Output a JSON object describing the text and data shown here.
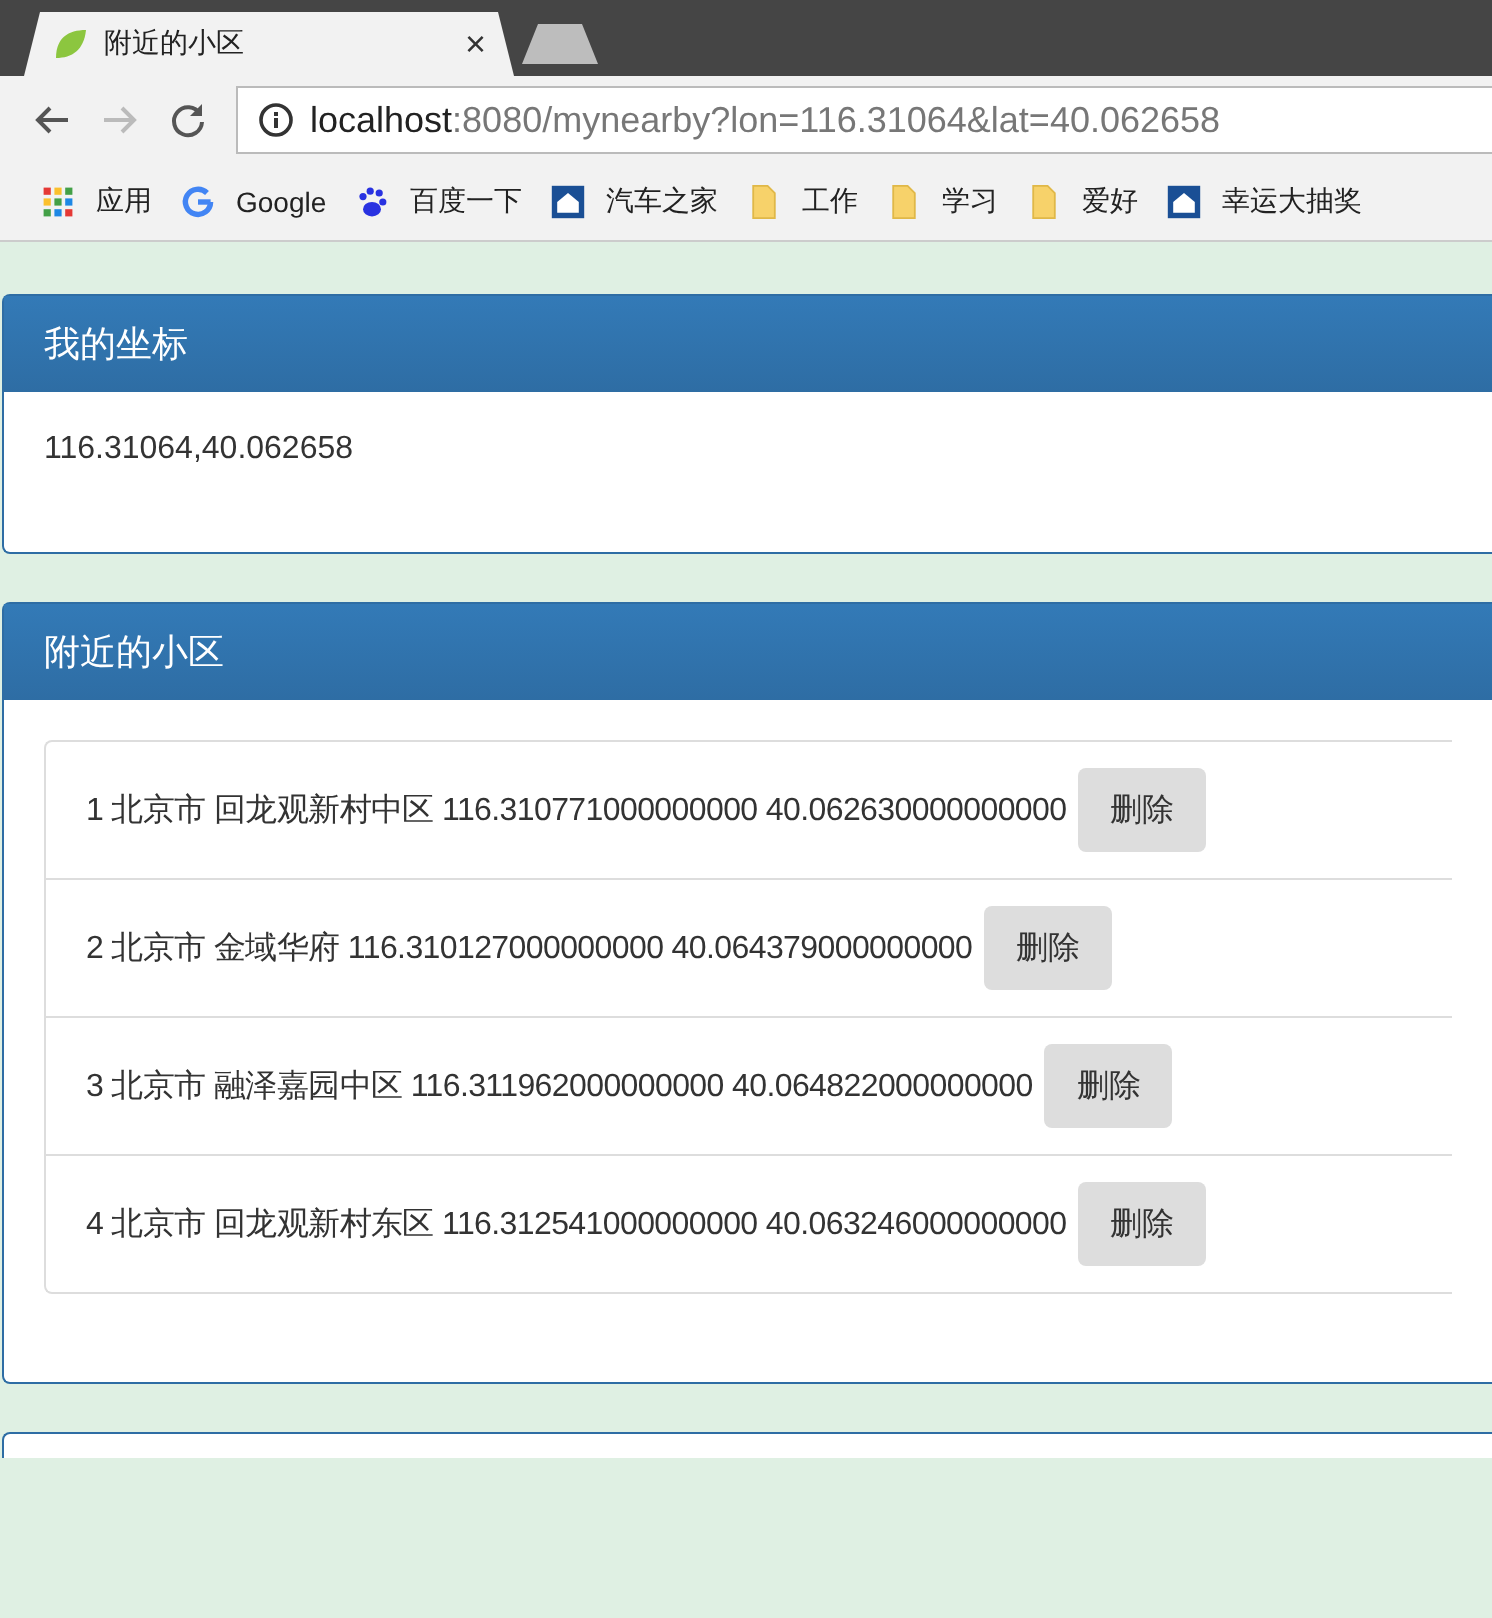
{
  "browser": {
    "tabs": [
      {
        "title": "附近的小区",
        "close": "×",
        "selected": true
      },
      {
        "selected": false
      }
    ],
    "address": {
      "host": "localhost",
      "path": ":8080/mynearby?lon=116.31064&lat=40.062658"
    },
    "bookmarks": [
      {
        "label": "应用",
        "kind": "apps"
      },
      {
        "label": "Google",
        "kind": "google"
      },
      {
        "label": "百度一下",
        "kind": "baidu"
      },
      {
        "label": "汽车之家",
        "kind": "home"
      },
      {
        "label": "工作",
        "kind": "folder"
      },
      {
        "label": "学习",
        "kind": "folder"
      },
      {
        "label": "爱好",
        "kind": "folder"
      },
      {
        "label": "幸运大抽奖",
        "kind": "home"
      }
    ]
  },
  "my_location": {
    "title": "我的坐标",
    "value": "116.31064,40.062658"
  },
  "nearby": {
    "title": "附近的小区",
    "items": [
      {
        "text": "1 北京市 回龙观新村中区 116.310771000000000 40.062630000000000",
        "button": "删除"
      },
      {
        "text": "2 北京市 金域华府 116.310127000000000 40.064379000000000",
        "button": "删除"
      },
      {
        "text": "3 北京市 融泽嘉园中区 116.311962000000000 40.064822000000000",
        "button": "删除"
      },
      {
        "text": "4 北京市 回龙观新村东区 116.312541000000000 40.063246000000000",
        "button": "删除"
      }
    ]
  }
}
